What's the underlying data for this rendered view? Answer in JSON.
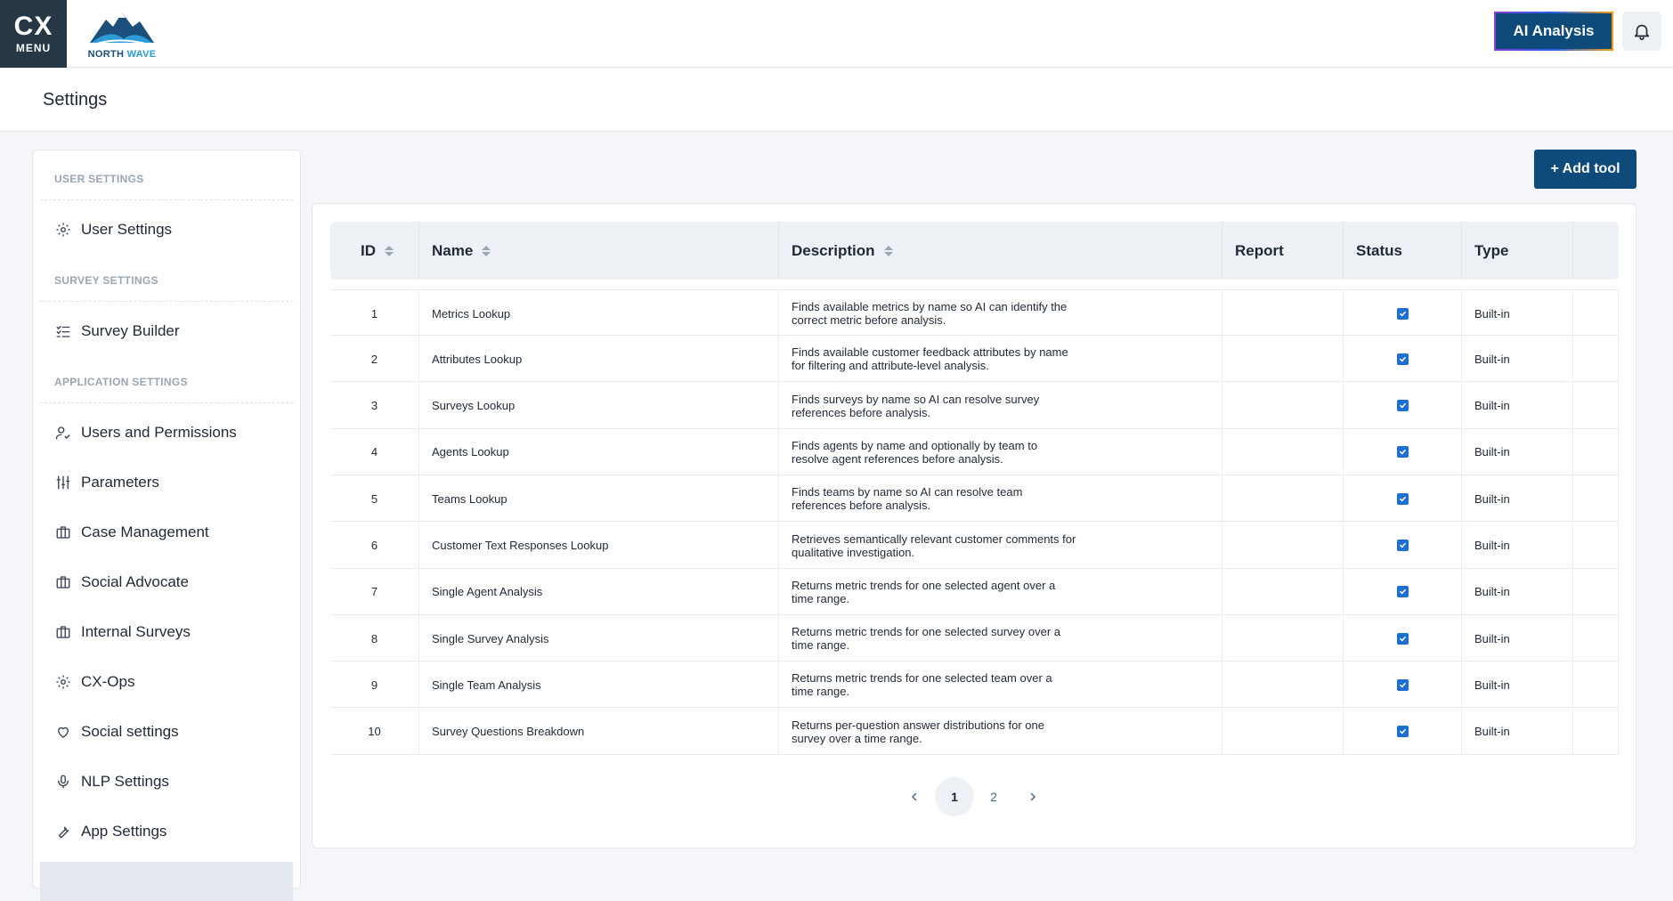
{
  "topbar": {
    "menu_logo": "CX",
    "menu_label": "MENU",
    "brand_word1": "NORTH",
    "brand_word2": "WAVE",
    "ai_button": "AI Analysis"
  },
  "page": {
    "title": "Settings"
  },
  "sidebar": {
    "sections": {
      "user": "USER SETTINGS",
      "survey": "SURVEY SETTINGS",
      "application": "APPLICATION SETTINGS"
    },
    "items": [
      {
        "label": "User Settings",
        "icon": "gear-icon"
      },
      {
        "label": "Survey Builder",
        "icon": "checklist-icon"
      },
      {
        "label": "Users and Permissions",
        "icon": "user-check-icon"
      },
      {
        "label": "Parameters",
        "icon": "sliders-icon"
      },
      {
        "label": "Case Management",
        "icon": "briefcase-icon"
      },
      {
        "label": "Social Advocate",
        "icon": "briefcase-icon"
      },
      {
        "label": "Internal Surveys",
        "icon": "briefcase-icon"
      },
      {
        "label": "CX-Ops",
        "icon": "gear-icon"
      },
      {
        "label": "Social settings",
        "icon": "heart-icon"
      },
      {
        "label": "NLP Settings",
        "icon": "microphone-icon"
      },
      {
        "label": "App Settings",
        "icon": "wrench-icon"
      }
    ]
  },
  "toolbar": {
    "add_tool": "+ Add tool"
  },
  "table": {
    "headers": {
      "id": "ID",
      "name": "Name",
      "description": "Description",
      "report": "Report",
      "status": "Status",
      "type": "Type"
    },
    "rows": [
      {
        "id": "1",
        "name": "Metrics Lookup",
        "description": "Finds available metrics by name so AI can identify the correct metric before analysis.",
        "report": "",
        "status": true,
        "type": "Built-in"
      },
      {
        "id": "2",
        "name": "Attributes Lookup",
        "description": "Finds available customer feedback attributes by name for filtering and attribute-level analysis.",
        "report": "",
        "status": true,
        "type": "Built-in"
      },
      {
        "id": "3",
        "name": "Surveys Lookup",
        "description": "Finds surveys by name so AI can resolve survey references before analysis.",
        "report": "",
        "status": true,
        "type": "Built-in"
      },
      {
        "id": "4",
        "name": "Agents Lookup",
        "description": "Finds agents by name and optionally by team to resolve agent references before analysis.",
        "report": "",
        "status": true,
        "type": "Built-in"
      },
      {
        "id": "5",
        "name": "Teams Lookup",
        "description": "Finds teams by name so AI can resolve team references before analysis.",
        "report": "",
        "status": true,
        "type": "Built-in"
      },
      {
        "id": "6",
        "name": "Customer Text Responses Lookup",
        "description": "Retrieves semantically relevant customer comments for qualitative investigation.",
        "report": "",
        "status": true,
        "type": "Built-in"
      },
      {
        "id": "7",
        "name": "Single Agent Analysis",
        "description": "Returns metric trends for one selected agent over a time range.",
        "report": "",
        "status": true,
        "type": "Built-in"
      },
      {
        "id": "8",
        "name": "Single Survey Analysis",
        "description": "Returns metric trends for one selected survey over a time range.",
        "report": "",
        "status": true,
        "type": "Built-in"
      },
      {
        "id": "9",
        "name": "Single Team Analysis",
        "description": "Returns metric trends for one selected team over a time range.",
        "report": "",
        "status": true,
        "type": "Built-in"
      },
      {
        "id": "10",
        "name": "Survey Questions Breakdown",
        "description": "Returns per-question answer distributions for one survey over a time range.",
        "report": "",
        "status": true,
        "type": "Built-in"
      }
    ]
  },
  "pagination": {
    "pages": [
      "1",
      "2"
    ],
    "current": "1"
  },
  "colors": {
    "primary": "#0e4a7a",
    "menu_bg": "#263745",
    "checkbox": "#1d6fd1",
    "header_bg": "#eef2f6"
  }
}
